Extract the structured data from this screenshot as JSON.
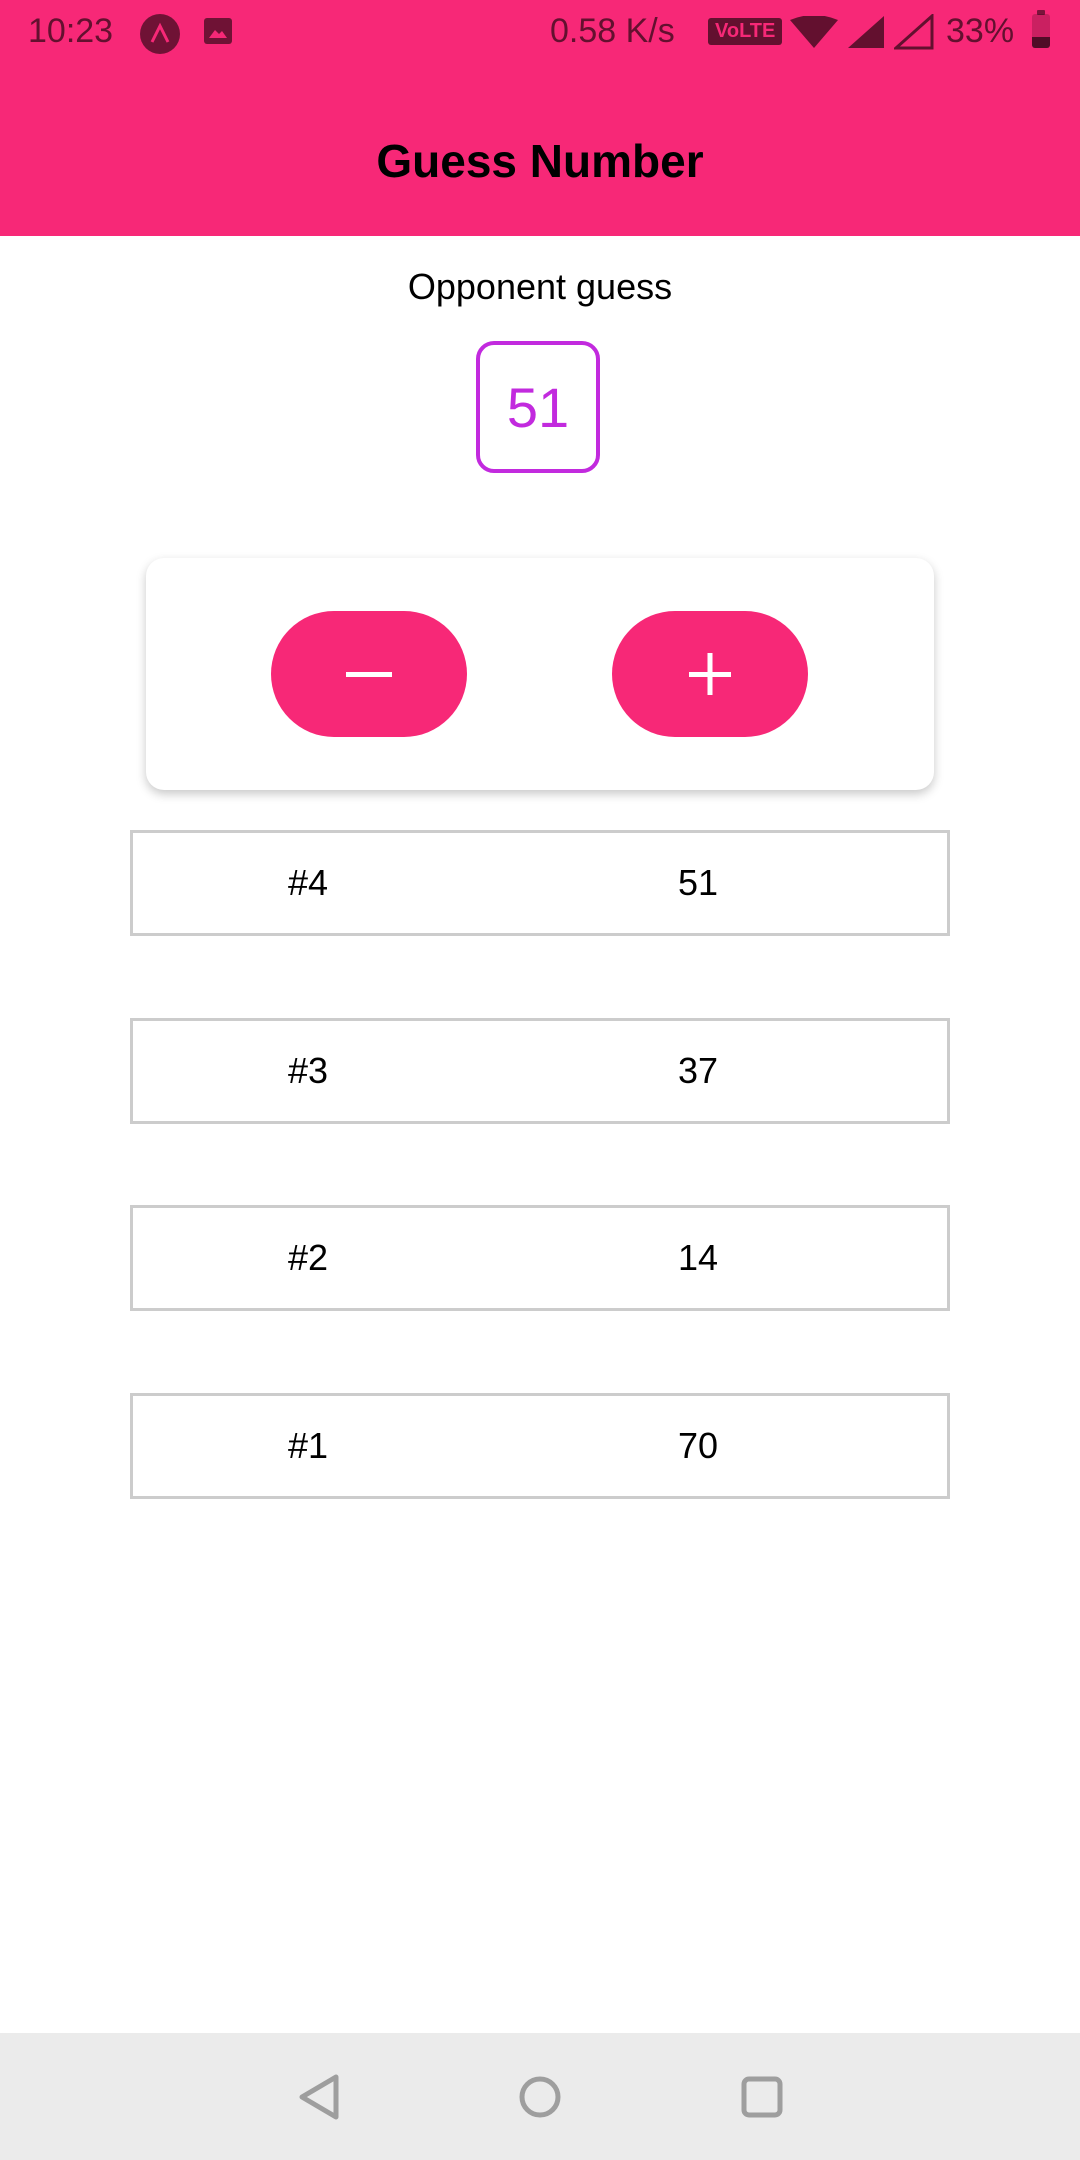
{
  "status_bar": {
    "time": "10:23",
    "net_speed": "0.58 K/s",
    "volte": "VoLTE",
    "battery": "33%",
    "battery_level": 0.33,
    "icons": [
      "app-notification-icon",
      "gallery-icon",
      "wifi-icon",
      "signal-icon",
      "signal-icon",
      "battery-icon"
    ]
  },
  "header": {
    "title": "Guess Number"
  },
  "opponent": {
    "label": "Opponent guess",
    "current_guess": "51"
  },
  "controls": {
    "minus_icon": "minus-icon",
    "plus_icon": "plus-icon",
    "accent_color": "#f72877",
    "guess_color": "#c22ade"
  },
  "guesses": [
    {
      "round": "#4",
      "value": "51"
    },
    {
      "round": "#3",
      "value": "37"
    },
    {
      "round": "#2",
      "value": "14"
    },
    {
      "round": "#1",
      "value": "70"
    }
  ],
  "nav_bar": {
    "icons": [
      "back-icon",
      "home-icon",
      "recents-icon"
    ]
  }
}
